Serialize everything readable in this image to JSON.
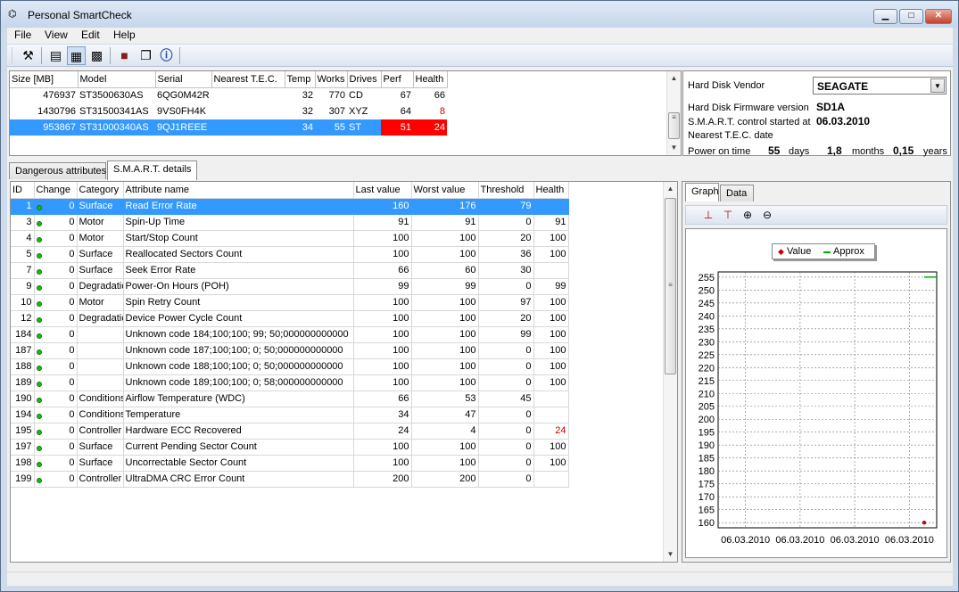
{
  "window": {
    "title": "Personal SmartCheck",
    "minimize": "▁",
    "maximize": "□",
    "close": "✕"
  },
  "menu": [
    "File",
    "View",
    "Edit",
    "Help"
  ],
  "toolbar": {
    "icons": [
      "settings-icon",
      "view-list-icon",
      "view-details-icon",
      "view-grid-icon",
      "book-icon",
      "window-icon",
      "info-icon"
    ]
  },
  "drives": {
    "columns": [
      "Size [MB]",
      "Model",
      "Serial",
      "Nearest T.E.C.",
      "Temp",
      "Works",
      "Drives",
      "Perf",
      "Health"
    ],
    "rows": [
      {
        "size": "476937",
        "model": "ST3500630AS",
        "serial": "6QG0M42R",
        "tec": "",
        "temp": "32",
        "works": "770",
        "drives": "CD",
        "perf": "67",
        "health": "66"
      },
      {
        "size": "1430796",
        "model": "ST31500341AS",
        "serial": "9VS0FH4K",
        "tec": "",
        "temp": "32",
        "works": "307",
        "drives": "XYZ",
        "perf": "64",
        "health": "8"
      },
      {
        "size": "953867",
        "model": "ST31000340AS",
        "serial": "9QJ1REEE",
        "tec": "",
        "temp": "34",
        "works": "55",
        "drives": "ST",
        "perf": "51",
        "health": "24"
      }
    ]
  },
  "info": {
    "vendor_label": "Hard Disk Vendor",
    "vendor": "SEAGATE",
    "firmware_label": "Hard Disk Firmware version",
    "firmware": "SD1A",
    "smart_label": "S.M.A.R.T. control started at",
    "smart_date": "06.03.2010",
    "tec_label": "Nearest T.E.C. date",
    "power_label": "Power on time",
    "days": "55",
    "days_unit": "days",
    "months": "1,8",
    "months_unit": "months",
    "years": "0,15",
    "years_unit": "years"
  },
  "tabs": [
    "Dangerous attributes",
    "S.M.A.R.T. details"
  ],
  "attributes": {
    "columns": [
      "ID",
      "Change",
      "Category",
      "Attribute name",
      "Last value",
      "Worst value",
      "Threshold",
      "Health"
    ],
    "rows": [
      {
        "id": "1",
        "change": "0",
        "category": "Surface",
        "name": "Read Error Rate",
        "last": "160",
        "worst": "176",
        "threshold": "79",
        "health": ""
      },
      {
        "id": "3",
        "change": "0",
        "category": "Motor",
        "name": "Spin-Up Time",
        "last": "91",
        "worst": "91",
        "threshold": "0",
        "health": "91"
      },
      {
        "id": "4",
        "change": "0",
        "category": "Motor",
        "name": "Start/Stop Count",
        "last": "100",
        "worst": "100",
        "threshold": "20",
        "health": "100"
      },
      {
        "id": "5",
        "change": "0",
        "category": "Surface",
        "name": "Reallocated Sectors Count",
        "last": "100",
        "worst": "100",
        "threshold": "36",
        "health": "100"
      },
      {
        "id": "7",
        "change": "0",
        "category": "Surface",
        "name": "Seek Error Rate",
        "last": "66",
        "worst": "60",
        "threshold": "30",
        "health": ""
      },
      {
        "id": "9",
        "change": "0",
        "category": "Degradatic",
        "name": "Power-On Hours (POH)",
        "last": "99",
        "worst": "99",
        "threshold": "0",
        "health": "99"
      },
      {
        "id": "10",
        "change": "0",
        "category": "Motor",
        "name": "Spin Retry Count",
        "last": "100",
        "worst": "100",
        "threshold": "97",
        "health": "100"
      },
      {
        "id": "12",
        "change": "0",
        "category": "Degradatic",
        "name": "Device Power Cycle Count",
        "last": "100",
        "worst": "100",
        "threshold": "20",
        "health": "100"
      },
      {
        "id": "184",
        "change": "0",
        "category": "",
        "name": "Unknown code 184;100;100; 99; 50;000000000000",
        "last": "100",
        "worst": "100",
        "threshold": "99",
        "health": "100"
      },
      {
        "id": "187",
        "change": "0",
        "category": "",
        "name": "Unknown code 187;100;100;  0; 50;000000000000",
        "last": "100",
        "worst": "100",
        "threshold": "0",
        "health": "100"
      },
      {
        "id": "188",
        "change": "0",
        "category": "",
        "name": "Unknown code 188;100;100;  0; 50;000000000000",
        "last": "100",
        "worst": "100",
        "threshold": "0",
        "health": "100"
      },
      {
        "id": "189",
        "change": "0",
        "category": "",
        "name": "Unknown code 189;100;100;  0; 58;000000000000",
        "last": "100",
        "worst": "100",
        "threshold": "0",
        "health": "100"
      },
      {
        "id": "190",
        "change": "0",
        "category": "Conditions",
        "name": "Airflow Temperature (WDC)",
        "last": "66",
        "worst": "53",
        "threshold": "45",
        "health": ""
      },
      {
        "id": "194",
        "change": "0",
        "category": "Conditions",
        "name": "Temperature",
        "last": "34",
        "worst": "47",
        "threshold": "0",
        "health": ""
      },
      {
        "id": "195",
        "change": "0",
        "category": "Controller",
        "name": "Hardware ECC Recovered",
        "last": "24",
        "worst": "4",
        "threshold": "0",
        "health": "24"
      },
      {
        "id": "197",
        "change": "0",
        "category": "Surface",
        "name": "Current Pending Sector Count",
        "last": "100",
        "worst": "100",
        "threshold": "0",
        "health": "100"
      },
      {
        "id": "198",
        "change": "0",
        "category": "Surface",
        "name": "Uncorrectable Sector Count",
        "last": "100",
        "worst": "100",
        "threshold": "0",
        "health": "100"
      },
      {
        "id": "199",
        "change": "0",
        "category": "Controller",
        "name": "UltraDMA CRC Error Count",
        "last": "200",
        "worst": "200",
        "threshold": "0",
        "health": ""
      }
    ]
  },
  "graph": {
    "tabs": [
      "Graph",
      "Data"
    ],
    "tool_icons": [
      "axis-marker-icon",
      "axis-range-icon",
      "zoom-in-icon",
      "zoom-out-icon"
    ]
  },
  "chart_data": {
    "type": "line",
    "legend": [
      "Value",
      "Approx"
    ],
    "legend_placement": "top",
    "y_ticks": [
      255,
      250,
      245,
      240,
      235,
      230,
      225,
      220,
      215,
      210,
      205,
      200,
      195,
      190,
      185,
      180,
      175,
      170,
      165,
      160
    ],
    "ylim": [
      158,
      257
    ],
    "x_ticks": [
      "06.03.2010",
      "06.03.2010",
      "06.03.2010",
      "06.03.2010"
    ],
    "grid": true,
    "series": [
      {
        "name": "Value",
        "values": [
          160
        ],
        "color": "#cc0000"
      },
      {
        "name": "Approx",
        "values": [
          255,
          255
        ],
        "color": "#00aa00"
      }
    ]
  },
  "colors": {
    "selection": "#3399ff",
    "danger": "#ff0000",
    "ok_dot": "#1cb51c"
  }
}
